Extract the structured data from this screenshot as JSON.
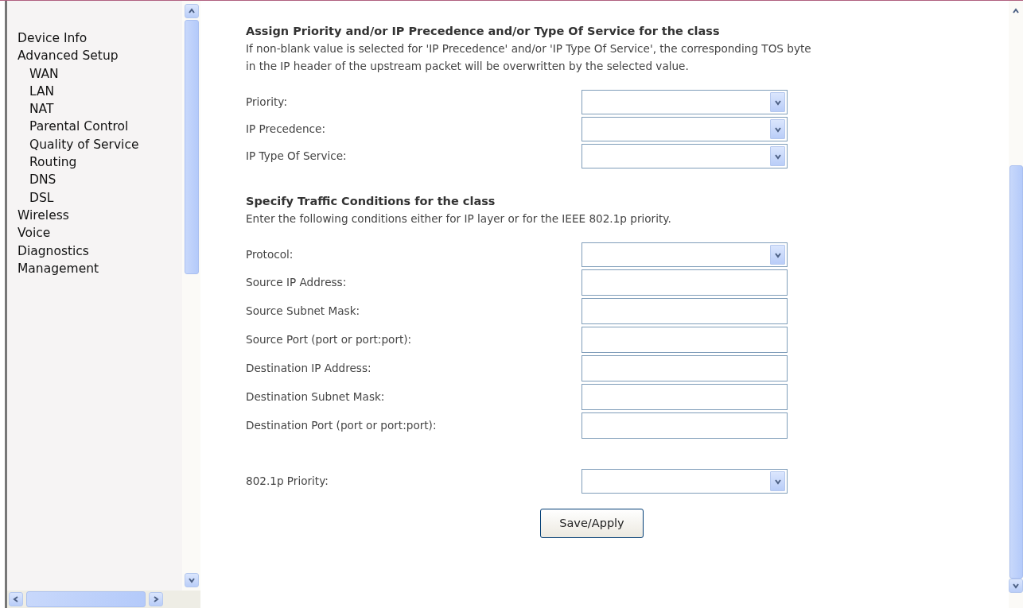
{
  "sidebar": {
    "items": [
      {
        "label": "Device Info"
      },
      {
        "label": "Advanced Setup",
        "children": [
          {
            "label": "WAN"
          },
          {
            "label": "LAN"
          },
          {
            "label": "NAT"
          },
          {
            "label": "Parental Control"
          },
          {
            "label": "Quality of Service"
          },
          {
            "label": "Routing"
          },
          {
            "label": "DNS"
          },
          {
            "label": "DSL"
          }
        ]
      },
      {
        "label": "Wireless"
      },
      {
        "label": "Voice"
      },
      {
        "label": "Diagnostics"
      },
      {
        "label": "Management"
      }
    ]
  },
  "sections": [
    {
      "title": "Assign Priority and/or IP Precedence and/or Type Of Service for the class",
      "description": [
        "If non-blank value is selected for 'IP Precedence' and/or 'IP Type Of Service', the corresponding TOS byte",
        "in the IP header of the upstream packet will be overwritten by the selected value."
      ],
      "groups": [
        [
          {
            "label": "Priority:",
            "kind": "select"
          },
          {
            "label": "IP Precedence:",
            "kind": "select"
          },
          {
            "label": "IP Type Of Service:",
            "kind": "select"
          }
        ]
      ]
    },
    {
      "title": "Specify Traffic Conditions for the class",
      "description": [
        "Enter the following conditions either for IP layer or for the IEEE 802.1p priority."
      ],
      "groups": [
        [
          {
            "label": "Protocol:",
            "kind": "select"
          },
          {
            "label": "Source IP Address:",
            "kind": "text"
          },
          {
            "label": "Source Subnet Mask:",
            "kind": "text"
          },
          {
            "label": "Source Port (port or port:port):",
            "kind": "text"
          },
          {
            "label": "Destination IP Address:",
            "kind": "text"
          },
          {
            "label": "Destination Subnet Mask:",
            "kind": "text"
          },
          {
            "label": "Destination Port (port or port:port):",
            "kind": "text"
          }
        ],
        [
          {
            "label": "802.1p Priority:",
            "kind": "select"
          }
        ]
      ]
    }
  ],
  "button": "Save/Apply"
}
